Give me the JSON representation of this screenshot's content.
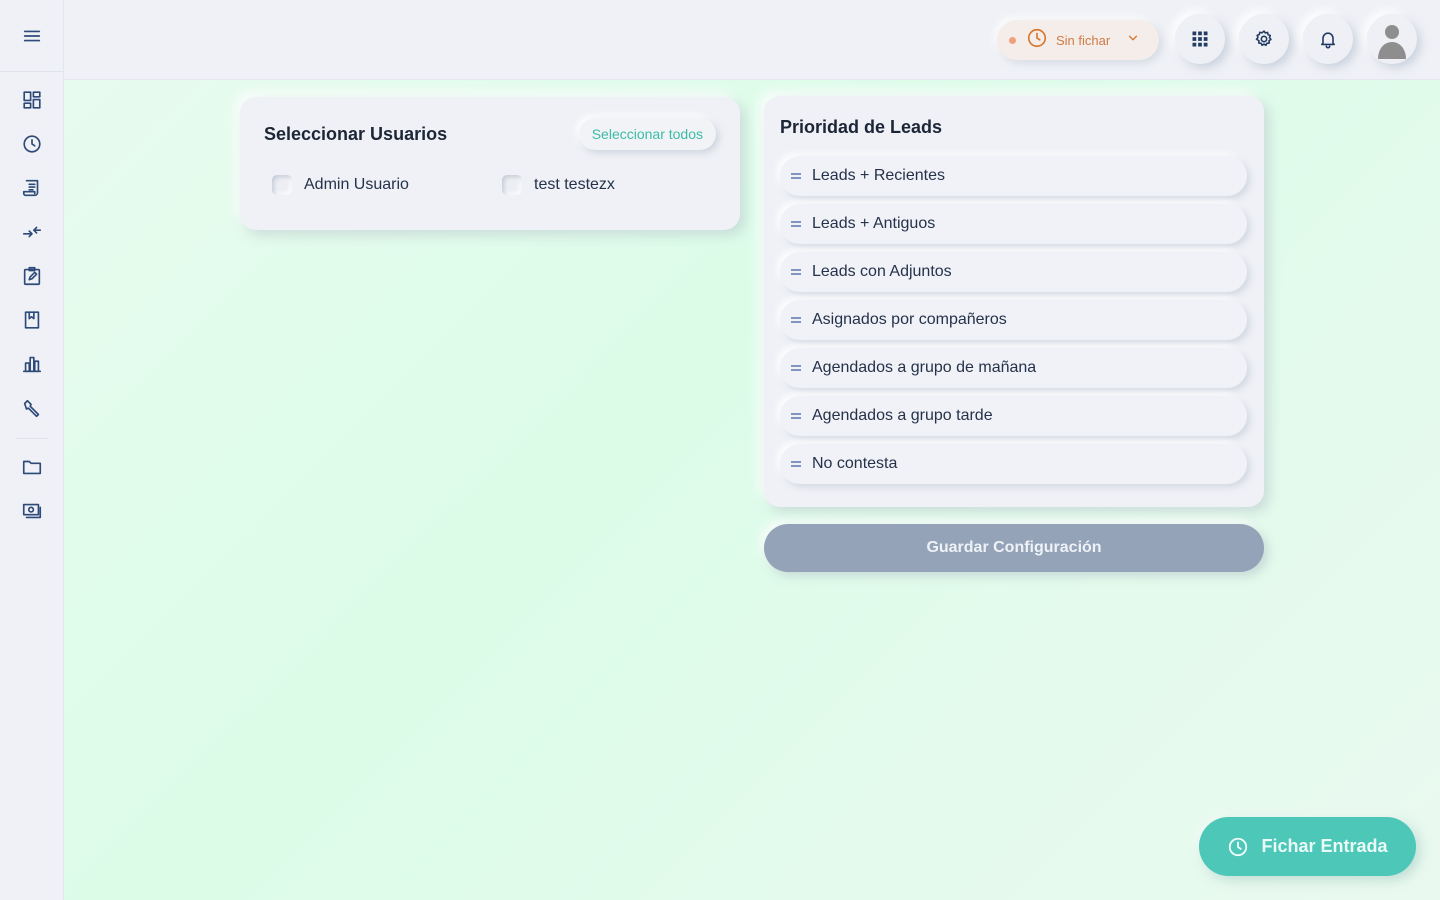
{
  "sidebar": {
    "items": [
      {
        "icon": "dashboard-icon"
      },
      {
        "icon": "clock-icon"
      },
      {
        "icon": "receipt-icon"
      },
      {
        "icon": "transfer-icon"
      },
      {
        "icon": "task-edit-icon"
      },
      {
        "icon": "bookmark-icon"
      },
      {
        "icon": "bar-chart-icon"
      },
      {
        "icon": "wrench-icon"
      },
      {
        "icon": "folder-icon"
      },
      {
        "icon": "money-icon"
      }
    ]
  },
  "topbar": {
    "clock_status": "Sin fichar",
    "status_color": "#d9772f"
  },
  "users_card": {
    "title": "Seleccionar Usuarios",
    "select_all_label": "Seleccionar todos",
    "users": [
      {
        "name": "Admin Usuario",
        "checked": false
      },
      {
        "name": "test testezx",
        "checked": false
      }
    ]
  },
  "leads_card": {
    "title": "Prioridad de Leads",
    "items": [
      "Leads + Recientes",
      "Leads + Antiguos",
      "Leads con Adjuntos",
      "Asignados por compañeros",
      "Agendados a grupo de mañana",
      "Agendados a grupo tarde",
      "No contesta"
    ]
  },
  "save_button_label": "Guardar Configuración",
  "clock_in_button_label": "Fichar Entrada",
  "colors": {
    "accent": "#4dc7b8",
    "save_button": "#94a3b8",
    "nav_icon": "#2e4a78"
  }
}
